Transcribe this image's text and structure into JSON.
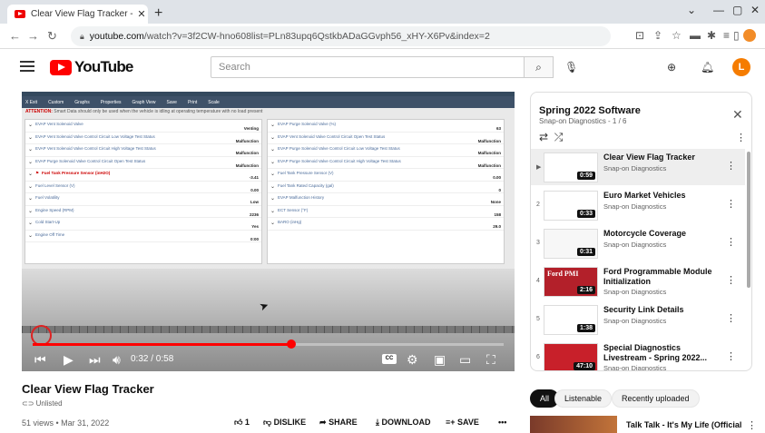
{
  "browser": {
    "tab_title": "Clear View Flag Tracker - YouTub",
    "url_host": "youtube.com",
    "url_path": "/watch?v=3f2CW-hno608list=PLn83upq6QstkbADaGGvph56_xHY-X6Pv&index=2"
  },
  "header": {
    "logo_text": "YouTube",
    "search_placeholder": "Search",
    "avatar_letter": "L",
    "colors": {
      "brand": "#ff0000",
      "avatar": "#f57c00"
    }
  },
  "screen_app": {
    "title_bar": "Smart Data",
    "toolbar": [
      "X  Exit",
      "Custom",
      "Graphs",
      "Properties",
      "Graph View",
      "Save",
      "Print",
      "Scale"
    ],
    "attention_label": "ATTENTION:",
    "attention_text": "Smart Data should only be used when the vehicle is idling at operating temperature with no load present",
    "left_rows": [
      {
        "name": "EVAP Vent Solenoid Valve",
        "value": "Venting"
      },
      {
        "name": "EVAP Vent Solenoid Valve Control Circuit Low Voltage Test Status",
        "value": "Malfunction"
      },
      {
        "name": "EVAP Vent Solenoid Valve Control Circuit High Voltage Test Status",
        "value": "Malfunction"
      },
      {
        "name": "EVAP Purge Solenoid Valve Control Circuit Open Test Status",
        "value": "Malfunction"
      },
      {
        "name": "Fuel Tank Pressure Sensor (inH2O)",
        "value": "-3.41"
      },
      {
        "name": "Fuel Level Sensor (V)",
        "value": "0.00"
      },
      {
        "name": "Fuel Volatility",
        "value": "Low"
      },
      {
        "name": "Engine Speed (RPM)",
        "value": "2236"
      },
      {
        "name": "Cold Start-Up",
        "value": "Yes"
      },
      {
        "name": "Engine Off Time",
        "value": "0:00"
      }
    ],
    "right_rows": [
      {
        "name": "EVAP Purge Solenoid Valve (%)",
        "value": "63"
      },
      {
        "name": "EVAP Vent Solenoid Valve Control Circuit Open Test Status",
        "value": "Malfunction"
      },
      {
        "name": "EVAP Purge Solenoid Valve Control Circuit Low Voltage Test Status",
        "value": "Malfunction"
      },
      {
        "name": "EVAP Purge Solenoid Valve Control Circuit High Voltage Test Status",
        "value": "Malfunction"
      },
      {
        "name": "Fuel Tank Pressure Sensor (V)",
        "value": "0.00"
      },
      {
        "name": "Fuel Tank Rated Capacity (gal)",
        "value": "0"
      },
      {
        "name": "EVAP Malfunction History",
        "value": "None"
      },
      {
        "name": "ECT Sensor (°F)",
        "value": "158"
      },
      {
        "name": "BARO (inHg)",
        "value": "29.0"
      }
    ]
  },
  "player": {
    "time_display": "0:32 / 0:58",
    "progress_fraction": 0.55,
    "cc_label": "CC"
  },
  "video": {
    "title": "Clear View Flag Tracker",
    "visibility": "Unlisted",
    "meta": "51 views • Mar 31, 2022",
    "likes": "1",
    "dislike_label": "DISLIKE",
    "share_label": "SHARE",
    "download_label": "DOWNLOAD",
    "save_label": "SAVE"
  },
  "playlist": {
    "title": "Spring 2022 Software",
    "subtitle": "Snap-on Diagnostics - 1 / 6",
    "items": [
      {
        "index": "▶",
        "title": "Clear View Flag Tracker",
        "channel": "Snap-on Diagnostics",
        "duration": "0:59",
        "thumb_text": ""
      },
      {
        "index": "2",
        "title": "Euro Market Vehicles",
        "channel": "Snap-on Diagnostics",
        "duration": "0:33",
        "thumb_text": ""
      },
      {
        "index": "3",
        "title": "Motorcycle Coverage",
        "channel": "Snap-on Diagnostics",
        "duration": "0:31",
        "thumb_text": ""
      },
      {
        "index": "4",
        "title": "Ford Programmable Module Initialization",
        "channel": "Snap-on Diagnostics",
        "duration": "2:16",
        "thumb_text": "Ford PMI"
      },
      {
        "index": "5",
        "title": "Security Link Details",
        "channel": "Snap-on Diagnostics",
        "duration": "1:38",
        "thumb_text": ""
      },
      {
        "index": "6",
        "title": "Special Diagnostics Livestream - Spring 2022...",
        "channel": "Snap-on Diagnostics",
        "duration": "47:10",
        "thumb_text": ""
      }
    ]
  },
  "chips": [
    "All",
    "Listenable",
    "Recently uploaded"
  ],
  "recommendation": {
    "title": "Talk Talk - It's My Life (Official"
  }
}
